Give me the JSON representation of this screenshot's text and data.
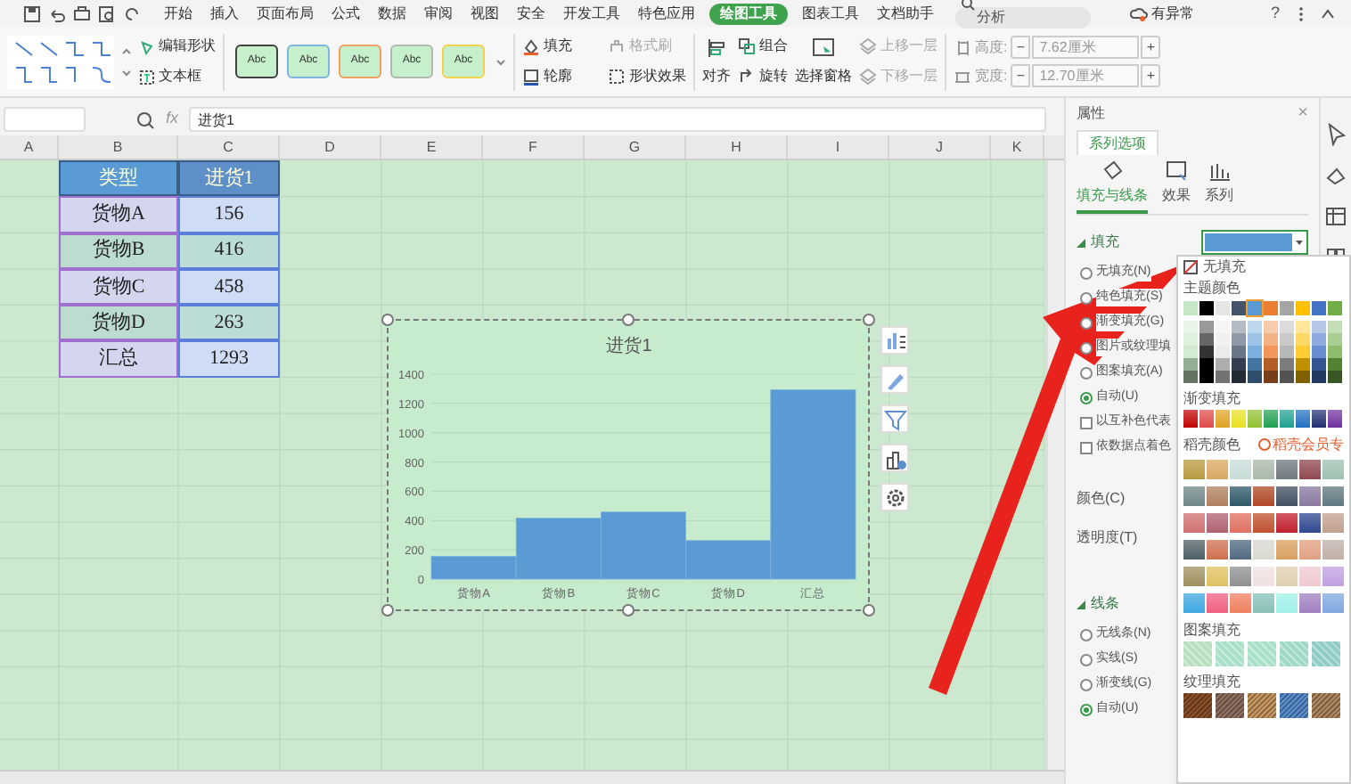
{
  "menu": {
    "tabs": [
      {
        "label": "开始",
        "selected": false
      },
      {
        "label": "插入",
        "selected": false
      },
      {
        "label": "页面布局",
        "selected": false
      },
      {
        "label": "公式",
        "selected": false
      },
      {
        "label": "数据",
        "selected": false
      },
      {
        "label": "审阅",
        "selected": false
      },
      {
        "label": "视图",
        "selected": false
      },
      {
        "label": "安全",
        "selected": false
      },
      {
        "label": "开发工具",
        "selected": false
      },
      {
        "label": "特色应用",
        "selected": false
      },
      {
        "label": "绘图工具",
        "selected": true
      },
      {
        "label": "图表工具",
        "selected": false
      },
      {
        "label": "文档助手",
        "selected": false
      }
    ],
    "search": {
      "placeholder": "分析"
    },
    "status": "有异常",
    "help": "?"
  },
  "ribbon": {
    "edit_shape": "编辑形状",
    "text_box": "文本框",
    "style_swatches": [
      {
        "label": "Abc",
        "color": "#404040"
      },
      {
        "label": "Abc",
        "color": "#7fb3e0"
      },
      {
        "label": "Abc",
        "color": "#f0a060"
      },
      {
        "label": "Abc",
        "color": "#b0b8b0"
      },
      {
        "label": "Abc",
        "color": "#f2d24a"
      }
    ],
    "format_commands": [
      {
        "label": "填充",
        "disabled": false
      },
      {
        "label": "格式刷",
        "disabled": true
      },
      {
        "label": "轮廓",
        "disabled": false
      },
      {
        "label": "形状效果",
        "disabled": false
      }
    ],
    "align": "对齐",
    "group": "组合",
    "rotate": "旋转",
    "selection_pane": "选择窗格",
    "layer_commands": [
      {
        "label": "上移一层",
        "disabled": true
      },
      {
        "label": "下移一层",
        "disabled": true
      }
    ],
    "size_fields": [
      {
        "label": "高度:",
        "value": "7.62厘米",
        "minus": "−",
        "plus": "+"
      },
      {
        "label": "宽度:",
        "value": "12.70厘米",
        "minus": "−",
        "plus": "+"
      }
    ]
  },
  "formula_bar": {
    "fx": "fx",
    "value": "进货1"
  },
  "sheet": {
    "columns": [
      "A",
      "B",
      "C",
      "D",
      "E",
      "F",
      "G",
      "H",
      "I",
      "J",
      "K"
    ],
    "table": {
      "header": [
        "类型",
        "进货1"
      ],
      "rows": [
        [
          "货物A",
          "156"
        ],
        [
          "货物B",
          "416"
        ],
        [
          "货物C",
          "458"
        ],
        [
          "货物D",
          "263"
        ],
        [
          "汇总",
          "1293"
        ]
      ]
    }
  },
  "chart": {
    "chart_data": {
      "type": "bar",
      "title": "进货1",
      "categories": [
        "货物A",
        "货物B",
        "货物C",
        "货物D",
        "汇总"
      ],
      "series": [
        {
          "color": "#5b9bd5",
          "values": [
            156,
            416,
            458,
            263,
            1293
          ]
        }
      ],
      "ylim": [
        0,
        1400
      ],
      "yticks": [
        0,
        200,
        400,
        600,
        800,
        1000,
        1200,
        1400
      ],
      "grid": true
    }
  },
  "panel": {
    "title": "属性",
    "close": "×",
    "series_tab": "系列选项",
    "subtabs": [
      {
        "label": "填充与线条",
        "selected": true
      },
      {
        "label": "效果",
        "selected": false
      },
      {
        "label": "系列",
        "selected": false
      }
    ],
    "fill": {
      "heading": "填充",
      "color": "#5b9bd5",
      "options": [
        {
          "label": "无填充(N)",
          "selected": false
        },
        {
          "label": "纯色填充(S)",
          "selected": false
        },
        {
          "label": "渐变填充(G)",
          "selected": false
        },
        {
          "label": "图片或纹理填",
          "selected": false
        },
        {
          "label": "图案填充(A)",
          "selected": false
        },
        {
          "label": "自动(U)",
          "selected": true
        }
      ],
      "checks": [
        {
          "label": "以互补色代表",
          "checked": false
        },
        {
          "label": "依数据点着色",
          "checked": false
        }
      ],
      "color_label": "颜色(C)",
      "transparency_label": "透明度(T)"
    },
    "line": {
      "heading": "线条",
      "options": [
        {
          "label": "无线条(N)",
          "selected": false
        },
        {
          "label": "实线(S)",
          "selected": false
        },
        {
          "label": "渐变线(G)",
          "selected": false
        },
        {
          "label": "自动(U)",
          "selected": true
        }
      ]
    }
  },
  "color_picker": {
    "no_fill": "无填充",
    "theme_heading": "主题颜色",
    "theme_colors": [
      {
        "color": "#c6e7c6",
        "selected": false
      },
      {
        "color": "#000000",
        "selected": false
      },
      {
        "color": "#e7e6e6",
        "selected": false
      },
      {
        "color": "#44546a",
        "selected": false
      },
      {
        "color": "#5b9bd5",
        "selected": true
      },
      {
        "color": "#ed7d31",
        "selected": false
      },
      {
        "color": "#a5a5a5",
        "selected": false
      },
      {
        "color": "#ffc000",
        "selected": false
      },
      {
        "color": "#4472c4",
        "selected": false
      },
      {
        "color": "#70ad47",
        "selected": false
      }
    ],
    "gradient_heading": "渐变填充",
    "gradients": [
      {
        "color": "#c00000"
      },
      {
        "color": "#e04848"
      },
      {
        "color": "#e0a020"
      },
      {
        "color": "#e8e020"
      },
      {
        "color": "#90c030"
      },
      {
        "color": "#20a050"
      },
      {
        "color": "#20a090"
      },
      {
        "color": "#2070c0"
      },
      {
        "color": "#203070"
      },
      {
        "color": "#7030a0"
      }
    ],
    "docer_heading": "稻壳颜色",
    "docer_badge": "稻壳会员专",
    "docer_colors": [
      {
        "color": "#b89a40"
      },
      {
        "color": "#d8a860"
      },
      {
        "color": "#c8dcd8"
      },
      {
        "color": "#a8b8a8"
      },
      {
        "color": "#707880"
      },
      {
        "color": "#904850"
      },
      {
        "color": "#a0c0b0"
      },
      {
        "color": "#708888"
      },
      {
        "color": "#b08060"
      },
      {
        "color": "#305868"
      },
      {
        "color": "#b04828"
      },
      {
        "color": "#405060"
      },
      {
        "color": "#8878a0"
      },
      {
        "color": "#607880"
      },
      {
        "color": "#d07070"
      },
      {
        "color": "#b06070"
      },
      {
        "color": "#e07060"
      },
      {
        "color": "#c05030"
      },
      {
        "color": "#c02030"
      },
      {
        "color": "#304890"
      },
      {
        "color": "#c0a090"
      },
      {
        "color": "#506068"
      },
      {
        "color": "#d07050"
      },
      {
        "color": "#506880"
      },
      {
        "color": "#d8d8d0"
      },
      {
        "color": "#d8a060"
      },
      {
        "color": "#e0a080"
      },
      {
        "color": "#c0b0a8"
      },
      {
        "color": "#a09060"
      },
      {
        "color": "#e0c060"
      },
      {
        "color": "#909090"
      },
      {
        "color": "#f0e0e0"
      },
      {
        "color": "#e0d0b0"
      },
      {
        "color": "#f0c8d0"
      },
      {
        "color": "#c0a0e0"
      },
      {
        "color": "#40a8e0"
      },
      {
        "color": "#f06080"
      },
      {
        "color": "#f08060"
      },
      {
        "color": "#88c0b8"
      },
      {
        "color": "#a0f0e8"
      },
      {
        "color": "#a080c0"
      },
      {
        "color": "#80a8e0"
      }
    ],
    "pattern_heading": "图案填充",
    "patterns": [
      {
        "color": "#b8e0c0"
      },
      {
        "color": "#a8e0c8"
      },
      {
        "color": "#a8e0c8"
      },
      {
        "color": "#a0d8c8"
      },
      {
        "color": "#90ccc8"
      }
    ],
    "texture_heading": "纹理填充",
    "textures": [
      {
        "color": "#8a5028"
      },
      {
        "color": "#907060"
      },
      {
        "color": "#c89860"
      },
      {
        "color": "#5b8fd0"
      },
      {
        "color": "#b08860"
      }
    ]
  }
}
